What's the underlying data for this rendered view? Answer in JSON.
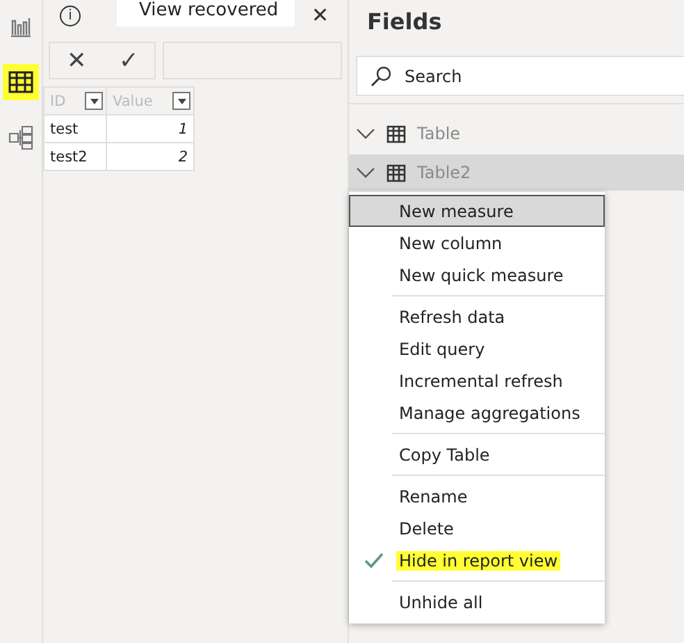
{
  "rail": [
    {
      "kind": "report",
      "selected": false,
      "highlighted": false
    },
    {
      "kind": "data",
      "selected": true,
      "highlighted": true
    },
    {
      "kind": "model",
      "selected": false,
      "highlighted": false
    }
  ],
  "toolbar": {
    "info": "i",
    "banner": "View recovered",
    "close": "✕"
  },
  "formula_bar": {
    "cancel": "✕",
    "commit": "✓"
  },
  "grid": {
    "columns": [
      "ID",
      "Value"
    ],
    "rows": [
      [
        "test",
        "1"
      ],
      [
        "test2",
        "2"
      ]
    ]
  },
  "fields": {
    "title": "Fields",
    "search": {
      "placeholder": "Search"
    },
    "tables": [
      {
        "name": "Table",
        "selected": false
      },
      {
        "name": "Table2",
        "selected": true
      }
    ]
  },
  "context_menu": {
    "groups": [
      [
        {
          "label": "New measure",
          "selected": true,
          "checked": false,
          "highlighted": false
        },
        {
          "label": "New column",
          "selected": false,
          "checked": false,
          "highlighted": false
        },
        {
          "label": "New quick measure",
          "selected": false,
          "checked": false,
          "highlighted": false
        }
      ],
      [
        {
          "label": "Refresh data",
          "selected": false,
          "checked": false,
          "highlighted": false
        },
        {
          "label": "Edit query",
          "selected": false,
          "checked": false,
          "highlighted": false
        },
        {
          "label": "Incremental refresh",
          "selected": false,
          "checked": false,
          "highlighted": false
        },
        {
          "label": "Manage aggregations",
          "selected": false,
          "checked": false,
          "highlighted": false
        }
      ],
      [
        {
          "label": "Copy Table",
          "selected": false,
          "checked": false,
          "highlighted": false
        }
      ],
      [
        {
          "label": "Rename",
          "selected": false,
          "checked": false,
          "highlighted": false
        },
        {
          "label": "Delete",
          "selected": false,
          "checked": false,
          "highlighted": false
        },
        {
          "label": "Hide in report view",
          "selected": false,
          "checked": true,
          "highlighted": true
        }
      ],
      [
        {
          "label": "Unhide all",
          "selected": false,
          "checked": false,
          "highlighted": false
        }
      ]
    ]
  }
}
